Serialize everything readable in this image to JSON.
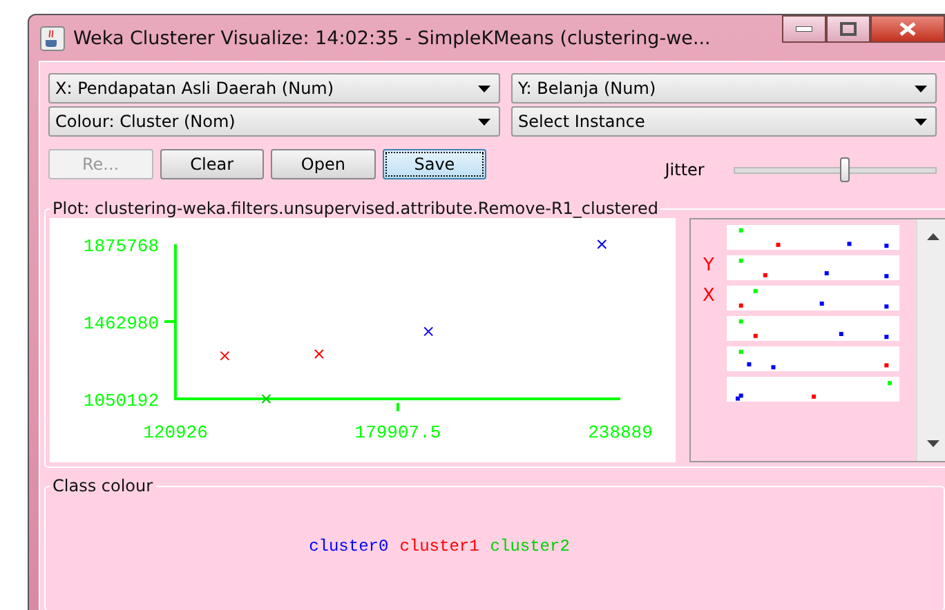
{
  "window": {
    "title": "Weka Clusterer Visualize: 14:02:35 - SimpleKMeans (clustering-we..."
  },
  "selectors": [
    {
      "label": "X: Pendapatan Asli Daerah (Num)"
    },
    {
      "label": "Y: Belanja (Num)"
    },
    {
      "label": "Colour: Cluster (Nom)"
    },
    {
      "label": "Select Instance"
    }
  ],
  "buttons": [
    {
      "label": "Re...",
      "disabled": true,
      "selected": false
    },
    {
      "label": "Clear",
      "disabled": false,
      "selected": false
    },
    {
      "label": "Open",
      "disabled": false,
      "selected": false
    },
    {
      "label": "Save",
      "disabled": false,
      "selected": true
    }
  ],
  "jitter": {
    "label": "Jitter",
    "level": 0.55
  },
  "plot": {
    "title": "Plot: clustering-weka.filters.unsupervised.attribute.Remove-R1_clustered",
    "chart_data": {
      "type": "scatter",
      "x": [
        134000,
        145000,
        159000,
        188000,
        234000
      ],
      "series": [
        {
          "name": "cluster0",
          "color": "#0000ff",
          "values": [
            null,
            null,
            null,
            1410000,
            1875768
          ]
        },
        {
          "name": "cluster1",
          "color": "#ff0000",
          "values": [
            1280000,
            null,
            1290000,
            null,
            null
          ]
        },
        {
          "name": "cluster2",
          "color": "#00d000",
          "values": [
            null,
            1050192,
            null,
            null,
            null
          ]
        }
      ],
      "xlim": [
        120926,
        238889
      ],
      "ylim": [
        1050192,
        1875768
      ],
      "xticks": [
        120926,
        179907.5,
        238889
      ],
      "yticks": [
        1050192,
        1462980,
        1875768
      ]
    }
  },
  "attribute_panel": {
    "labels": [
      "Y",
      "X"
    ]
  },
  "class_colour": {
    "title": "Class colour"
  }
}
